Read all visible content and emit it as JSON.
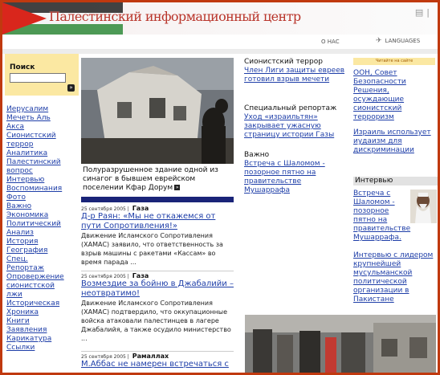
{
  "header": {
    "title": "Палестинский информационный центр",
    "about_label": "О НАС",
    "languages_label": "LANGUAGES",
    "icons": [
      "lang-icon",
      "print-icon",
      "share-icon"
    ],
    "colors": {
      "frame": "#c0390f",
      "navy": "#1a2478",
      "link": "#1e3ea8",
      "search_bg": "#fbe8a2"
    }
  },
  "search": {
    "title": "Поиск",
    "placeholder": ""
  },
  "menu": [
    "Иерусалим",
    "Мечеть Аль",
    "Акса",
    "Сионистский",
    "террор",
    "Аналитика",
    "Палестинский",
    "вопрос",
    "Интервью",
    "Воспоминания",
    "Фото",
    "Важно",
    "Экономика",
    "Политический",
    "Анализ",
    "История",
    "География",
    "Спец.",
    "Репортаж",
    "Опровержение",
    "сионистской",
    "лжи",
    "Историческая",
    "Хроника",
    "Книги",
    "Заявления",
    "Карикатура",
    "Ссылки"
  ],
  "hero": {
    "caption": "Полуразрушенное здание одной из синагог в бывшем еврейском поселении Кфар Дорум"
  },
  "news": [
    {
      "date": "25 сентября 2005",
      "location": "Газа",
      "title": "Д-р Раян: «Мы не откажемся от пути Сопротивления!»",
      "text": "Движение Исламского Сопротивления (ХАМАС) заявило, что ответственность за взрыв машины с ракетами «Кассам» во время парада ..."
    },
    {
      "date": "25 сентября 2005",
      "location": "Газа",
      "title": "Возмездие за бойню в Джабалийи – неотвратимо!",
      "text": "Движение Исламского Сопротивления (ХАМАС) подтвердило, что оккупационные войска атаковали палестинцев в лагере Джабалийя, а также осудило министерство ..."
    },
    {
      "date": "25 сентября 2005",
      "location": "Рамаллах",
      "title": "М.Аббас не намерен встречаться с",
      "text": ""
    }
  ],
  "col3": {
    "sections": [
      {
        "heading": "Сионистский террор",
        "link": "Член Лиги защиты евреев готовил взрыв мечети"
      },
      {
        "heading": "Специальный репортаж",
        "link": "Уход «израильтян» закрывает ужасную страницу истории Газы"
      },
      {
        "heading": "Важно",
        "link": "Встреча с Шаломом - позорное пятно на правительстве Мушаррафа"
      }
    ]
  },
  "col4": {
    "read_site": "Читайте на сайте",
    "links": [
      "ООН, Совет Безопасности Решения, осуждающие сионистский терроризм",
      "Израиль использует иудаизм для дискриминации"
    ],
    "interview_heading": "Интервью",
    "interview_links": [
      "Встреча с Шаломом - позорное пятно на правительстве Мушаррафа.",
      "Интервью с лидером крупнейшей мусульманской политической организации в Пакистане"
    ]
  }
}
